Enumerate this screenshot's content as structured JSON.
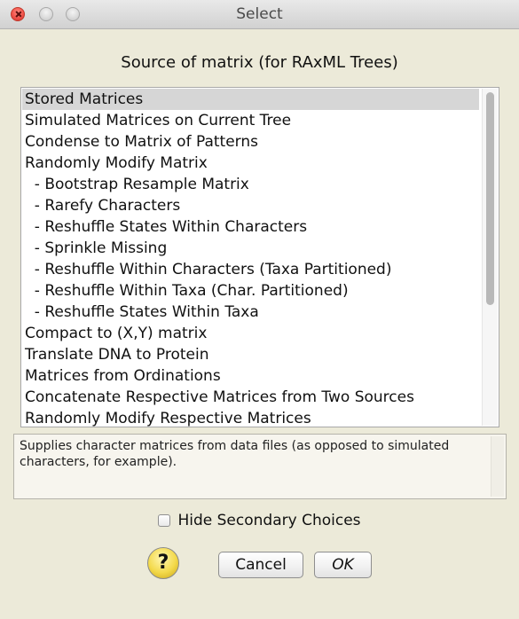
{
  "window": {
    "title": "Select"
  },
  "dialog": {
    "heading": "Source of matrix (for RAxML Trees)",
    "items": [
      {
        "label": "Stored Matrices",
        "selected": true
      },
      {
        "label": "Simulated Matrices on Current Tree",
        "selected": false
      },
      {
        "label": "Condense to Matrix of Patterns",
        "selected": false
      },
      {
        "label": "Randomly Modify Matrix",
        "selected": false
      },
      {
        "label": "  - Bootstrap Resample Matrix",
        "selected": false
      },
      {
        "label": "  - Rarefy Characters",
        "selected": false
      },
      {
        "label": "  - Reshuffle States Within Characters",
        "selected": false
      },
      {
        "label": "  - Sprinkle Missing",
        "selected": false
      },
      {
        "label": "  - Reshuffle Within Characters (Taxa Partitioned)",
        "selected": false
      },
      {
        "label": "  - Reshuffle Within Taxa (Char. Partitioned)",
        "selected": false
      },
      {
        "label": "  - Reshuffle States Within Taxa",
        "selected": false
      },
      {
        "label": "Compact to (X,Y) matrix",
        "selected": false
      },
      {
        "label": "Translate DNA to Protein",
        "selected": false
      },
      {
        "label": "Matrices from Ordinations",
        "selected": false
      },
      {
        "label": "Concatenate Respective Matrices from Two Sources",
        "selected": false
      },
      {
        "label": "Randomly Modify Respective Matrices",
        "selected": false
      }
    ],
    "description": "Supplies character matrices from data files (as opposed to simulated characters, for example).",
    "hide_secondary_label": "Hide Secondary Choices",
    "hide_secondary_checked": false,
    "help_label": "?",
    "cancel_label": "Cancel",
    "ok_label": "OK"
  },
  "colors": {
    "selection": "#d6d6d6",
    "window_bg": "#ecead9"
  }
}
